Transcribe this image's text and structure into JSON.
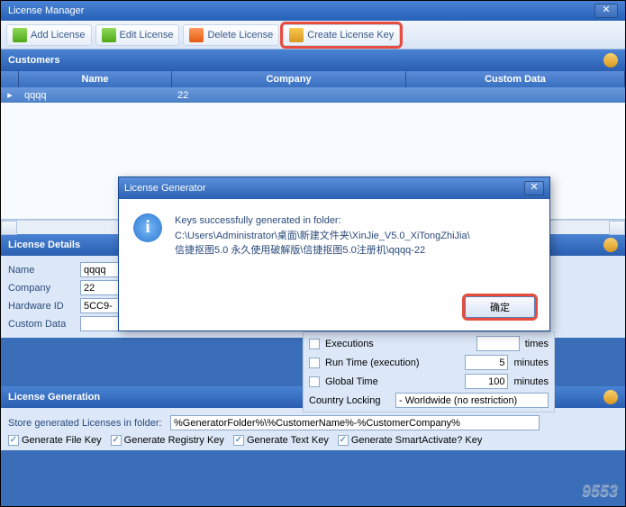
{
  "window": {
    "title": "License Manager"
  },
  "toolbar": {
    "add": "Add License",
    "edit": "Edit License",
    "del": "Delete License",
    "create_key": "Create License Key"
  },
  "customers": {
    "header": "Customers",
    "cols": {
      "name": "Name",
      "company": "Company",
      "custom": "Custom Data"
    },
    "row": {
      "name": "qqqq",
      "company": "22"
    }
  },
  "details": {
    "header": "License Details",
    "name_lbl": "Name",
    "name_val": "qqqq",
    "company_lbl": "Company",
    "company_val": "22",
    "hwid_lbl": "Hardware ID",
    "hwid_val": "5CC9-",
    "custom_lbl": "Custom Data"
  },
  "limits": {
    "exec_lbl": "Executions",
    "times": "times",
    "runtime_lbl": "Run Time (execution)",
    "runtime_val": "5",
    "runtime_unit": "minutes",
    "global_lbl": "Global Time",
    "global_val": "100",
    "global_unit": "minutes",
    "country_lbl": "Country Locking",
    "country_val": "- Worldwide (no restriction)"
  },
  "gen": {
    "header": "License Generation",
    "store_lbl": "Store generated Licenses in folder:",
    "store_val": "%GeneratorFolder%\\%CustomerName%-%CustomerCompany%",
    "file_key": "Generate File Key",
    "reg_key": "Generate Registry Key",
    "text_key": "Generate Text Key",
    "smart_key": "Generate SmartActivate? Key"
  },
  "modal": {
    "title": "License Generator",
    "line1": "Keys successfully generated in folder:",
    "line2": "C:\\Users\\Administrator\\桌面\\新建文件夹\\XinJie_V5.0_XiTongZhiJia\\",
    "line3": "信捷抠图5.0 永久使用破解版\\信捷抠图5.0注册机\\qqqq-22",
    "ok": "确定"
  },
  "watermark": "9553"
}
